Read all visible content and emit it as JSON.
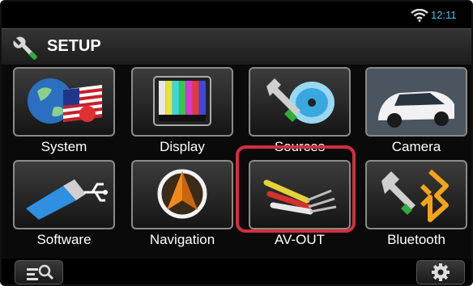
{
  "status": {
    "time": "12:11"
  },
  "header": {
    "title": "SETUP",
    "icon": "wrench-icon"
  },
  "tiles": [
    {
      "label": "System",
      "icon": "globe-flag-icon"
    },
    {
      "label": "Display",
      "icon": "color-bars-icon"
    },
    {
      "label": "Sources",
      "icon": "disc-wrench-icon"
    },
    {
      "label": "Camera",
      "icon": "car-camera-icon"
    },
    {
      "label": "Software",
      "icon": "usb-icon"
    },
    {
      "label": "Navigation",
      "icon": "navigation-arrow-icon"
    },
    {
      "label": "AV-OUT",
      "icon": "rca-cables-icon"
    },
    {
      "label": "Bluetooth",
      "icon": "bluetooth-icon"
    }
  ],
  "bottom": {
    "left_icon": "search-list-icon",
    "right_icon": "gear-icon"
  },
  "colors": {
    "highlight": "#d22f3a",
    "clock": "#39c9e8"
  }
}
